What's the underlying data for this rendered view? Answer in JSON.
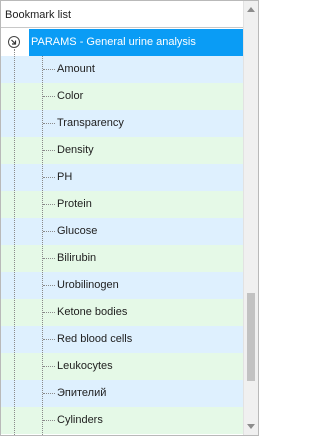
{
  "panel": {
    "title": "Bookmark list"
  },
  "tree": {
    "root_label": "PARAMS - General urine analysis",
    "items": [
      "Amount",
      "Color",
      "Transparency",
      "Density",
      "PH",
      "Protein",
      "Glucose",
      "Bilirubin",
      "Urobilinogen",
      "Ketone bodies",
      "Red blood cells",
      "Leukocytes",
      "Эпителий",
      "Cylinders"
    ]
  },
  "colors": {
    "selected_row": "#0a9cf5",
    "row_tint_a": "#def0fe",
    "row_tint_b": "#e5f9e7"
  },
  "icons": {
    "expander": "collapse-arrow-circle-icon",
    "scroll_up": "scroll-up-arrow-icon",
    "scroll_down": "scroll-down-arrow-icon"
  }
}
